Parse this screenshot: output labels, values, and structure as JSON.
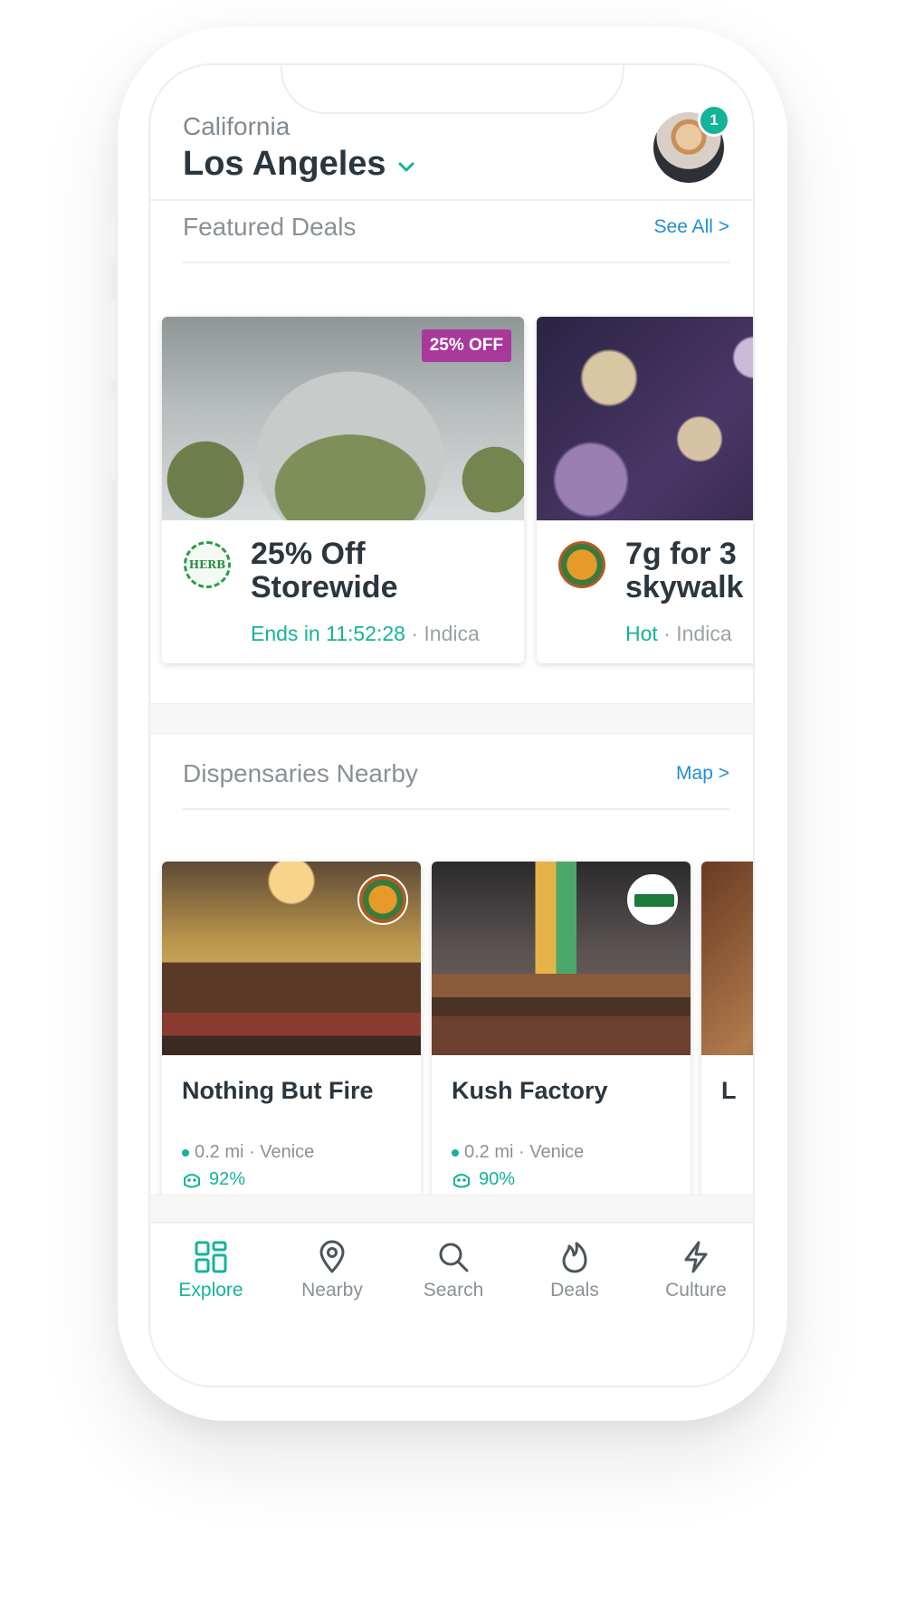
{
  "header": {
    "state": "California",
    "city": "Los Angeles",
    "notification_count": "1"
  },
  "featured": {
    "title": "Featured Deals",
    "link": "See All >",
    "deals": [
      {
        "badge": "25% OFF",
        "logo": "HERB",
        "title": "25% Off\nStorewide",
        "title_line1": "25% Off",
        "title_line2": "Storewide",
        "status": "Ends in 11:52:28",
        "separator": " · ",
        "category": "Indica",
        "logo_icon": "herb-logo"
      },
      {
        "title_line1": "7g for 3",
        "title_line2": "skywalk",
        "status": "Hot",
        "separator": " · ",
        "category": "Indica",
        "logo_icon": "buddys-logo"
      }
    ]
  },
  "dispensaries": {
    "title": "Dispensaries Nearby",
    "link": "Map >",
    "items": [
      {
        "name": "Nothing But Fire",
        "distance": "0.2 mi · Venice",
        "rating": "92%",
        "logo_icon": "buddys-logo"
      },
      {
        "name": "Kush Factory",
        "distance": "0.2 mi · Venice",
        "rating": "90%",
        "logo_icon": "kush-factory-logo"
      },
      {
        "name": "L"
      }
    ]
  },
  "tabs": [
    {
      "label": "Explore",
      "icon": "grid-icon",
      "active": true
    },
    {
      "label": "Nearby",
      "icon": "map-pin-icon",
      "active": false
    },
    {
      "label": "Search",
      "icon": "search-icon",
      "active": false
    },
    {
      "label": "Deals",
      "icon": "flame-icon",
      "active": false
    },
    {
      "label": "Culture",
      "icon": "lightning-icon",
      "active": false
    }
  ],
  "colors": {
    "accent": "#14b39a",
    "link": "#1e8fd6",
    "badge": "#a8399b",
    "text_dark": "#2a3640",
    "text_muted": "#8a9196"
  }
}
